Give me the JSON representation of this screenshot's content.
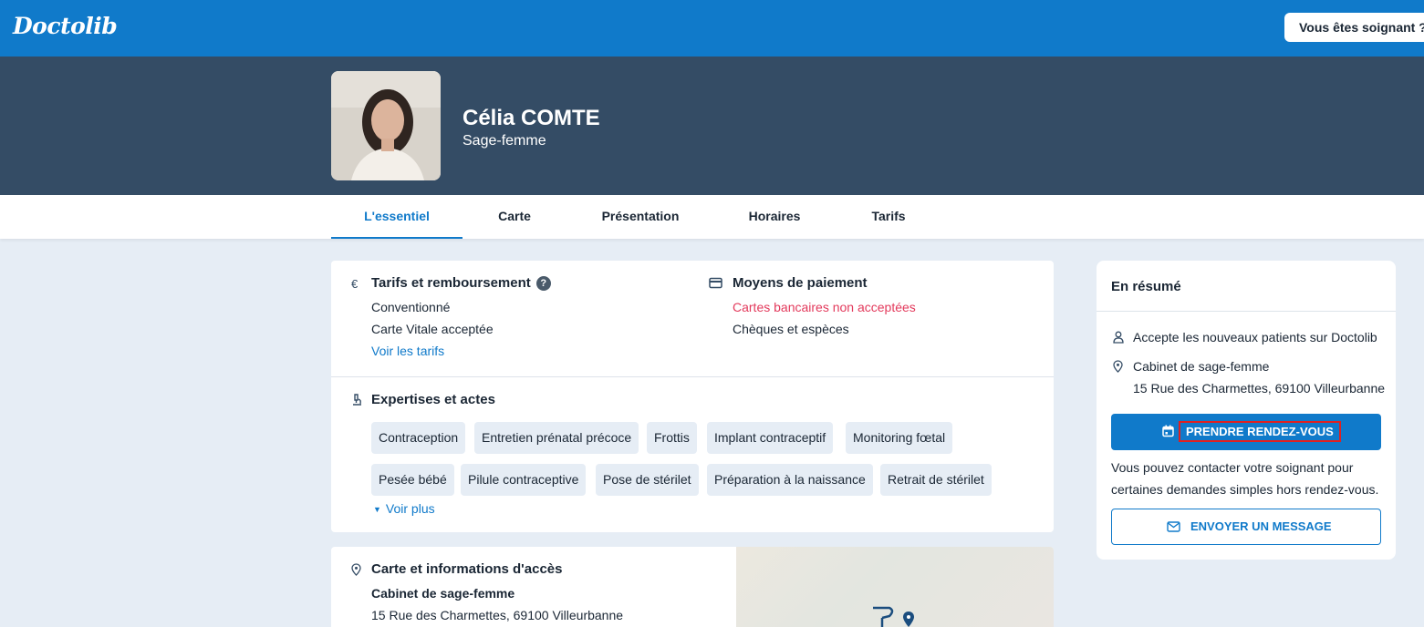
{
  "app": {
    "logo": "Doctolib",
    "pro_button": "Vous êtes soignant ?"
  },
  "doctor": {
    "name": "Célia COMTE",
    "specialty": "Sage-femme"
  },
  "tabs": [
    {
      "label": "L'essentiel",
      "active": true
    },
    {
      "label": "Carte",
      "active": false
    },
    {
      "label": "Présentation",
      "active": false
    },
    {
      "label": "Horaires",
      "active": false
    },
    {
      "label": "Tarifs",
      "active": false
    }
  ],
  "tarifs": {
    "title": "Tarifs et remboursement",
    "help": "?",
    "lines": [
      "Conventionné",
      "Carte Vitale acceptée"
    ],
    "link": "Voir les tarifs"
  },
  "paiement": {
    "title": "Moyens de paiement",
    "lines": [
      "Cartes bancaires non acceptées",
      "Chèques et espèces"
    ]
  },
  "expertises": {
    "title": "Expertises et actes",
    "chips": [
      "Contraception",
      "Entretien prénatal précoce",
      "Frottis",
      "Implant contraceptif",
      "Monitoring fœtal",
      "Pesée bébé",
      "Pilule contraceptive",
      "Pose de stérilet",
      "Préparation à la naissance",
      "Retrait de stérilet"
    ],
    "more": "Voir plus"
  },
  "acces": {
    "title": "Carte et informations d'accès",
    "place": "Cabinet de sage-femme",
    "address": "15 Rue des Charmettes, 69100 Villeurbanne"
  },
  "summary": {
    "title": "En résumé",
    "new_patients": "Accepte les nouveaux patients sur Doctolib",
    "place": "Cabinet de sage-femme",
    "address": "15 Rue des Charmettes, 69100 Villeurbanne",
    "book_button": "PRENDRE RENDEZ-VOUS",
    "contact_text_1": "Vous pouvez contacter votre soignant pour",
    "contact_text_2": "certaines demandes simples hors rendez-vous.",
    "message_button": "ENVOYER UN MESSAGE"
  },
  "colors": {
    "brand": "#107aca",
    "hero": "#344c65",
    "warning": "#e33a5c"
  },
  "icons": [
    "euro-icon",
    "card-icon",
    "microscope-icon",
    "pin-icon",
    "user-icon",
    "calendar-icon",
    "mail-icon",
    "caret-down-icon"
  ]
}
